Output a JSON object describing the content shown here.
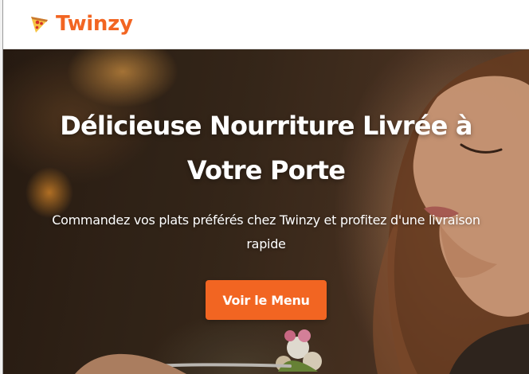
{
  "brand": {
    "name": "Twinzy",
    "logo_icon": "pizza-slice-icon",
    "accent_color": "#f26522"
  },
  "hero": {
    "title": "Délicieuse Nourriture Livrée à Votre Porte",
    "subtitle": "Commandez vos plats préférés chez Twinzy et profitez d'une livraison rapide",
    "cta_label": "Voir le Menu"
  }
}
